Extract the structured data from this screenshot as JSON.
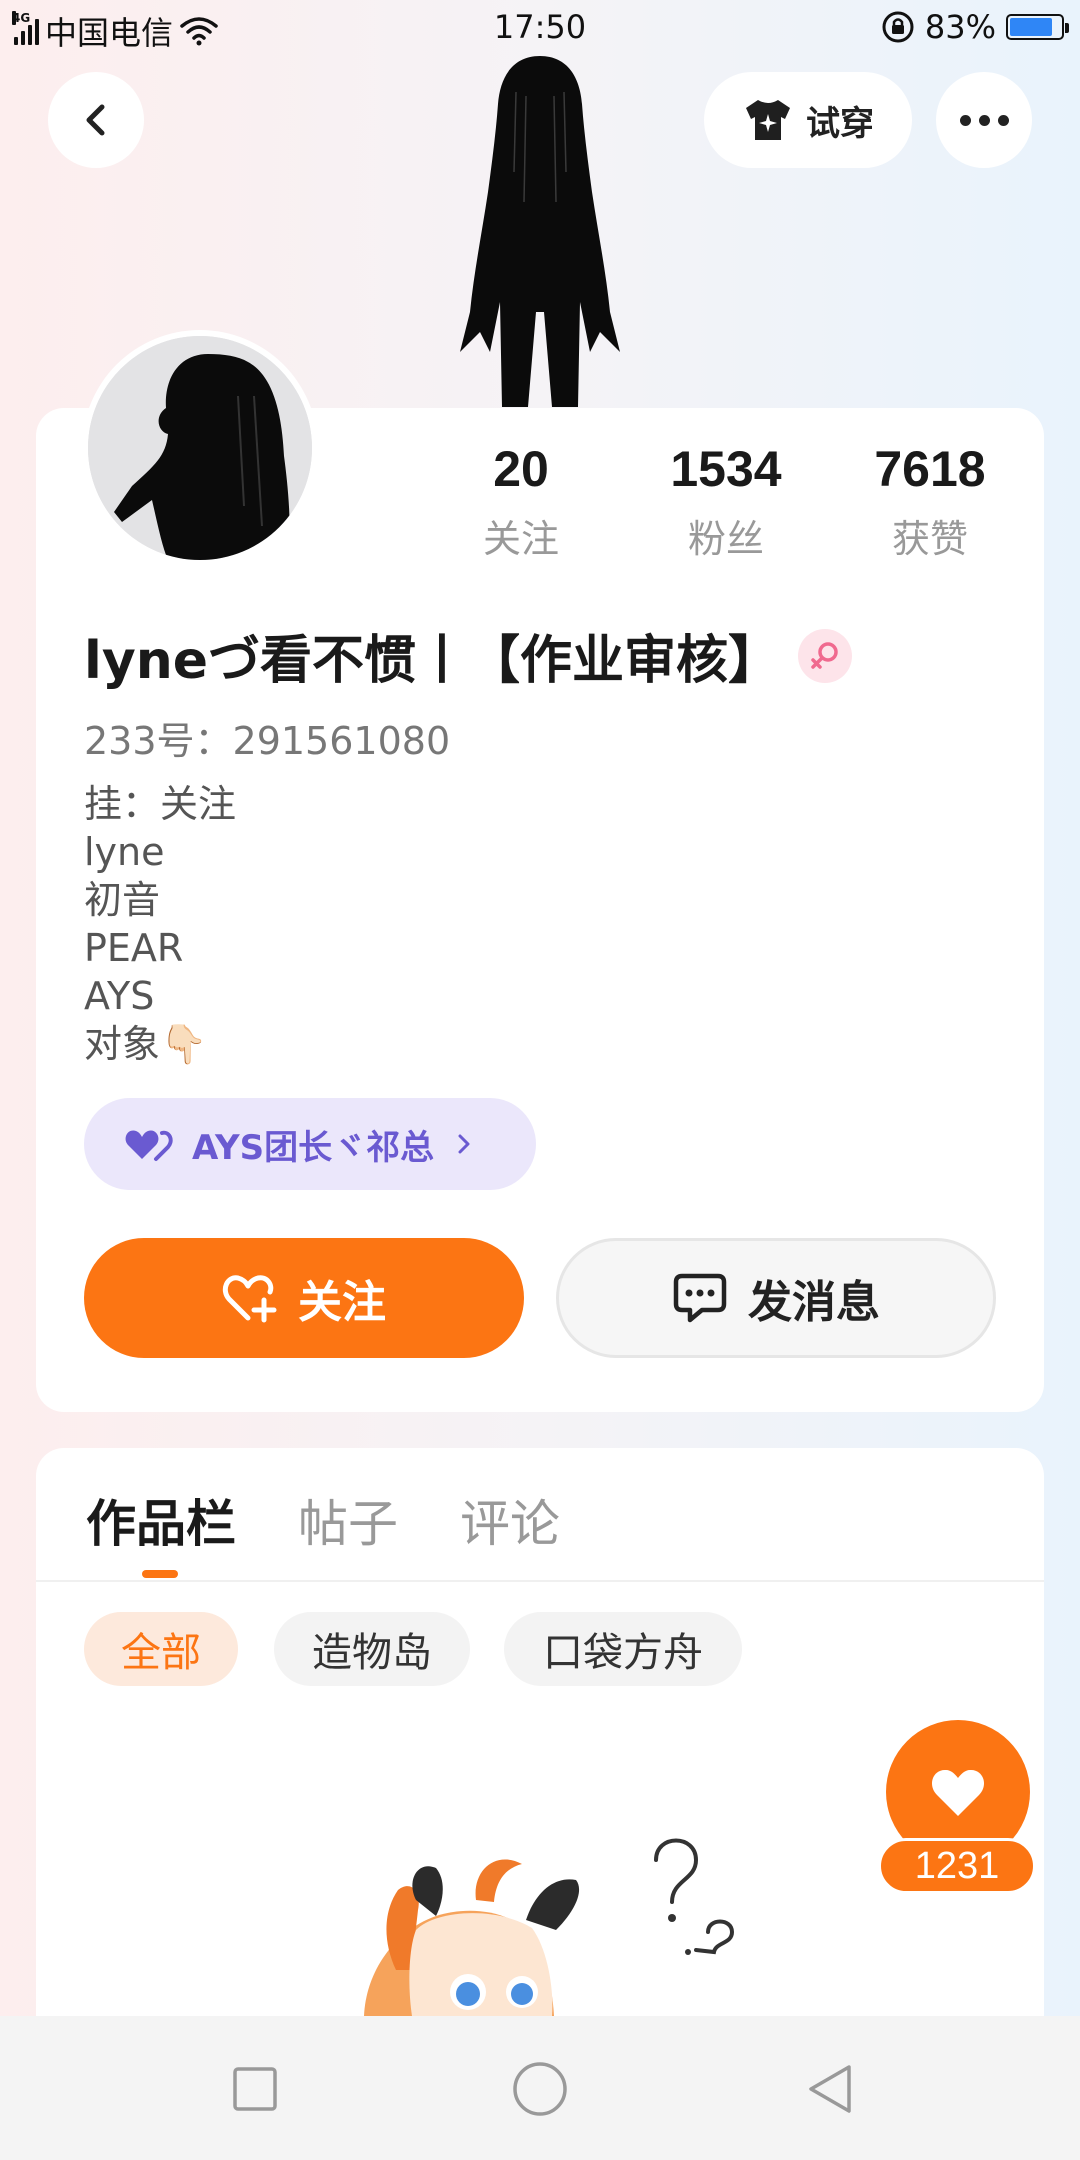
{
  "status_bar": {
    "network": "4G",
    "carrier": "中国电信",
    "time": "17:50",
    "battery_percent": "83%",
    "battery_level": 0.83
  },
  "top": {
    "tryon_label": "试穿"
  },
  "profile": {
    "stats": [
      {
        "value": "20",
        "label": "关注"
      },
      {
        "value": "1534",
        "label": "粉丝"
      },
      {
        "value": "7618",
        "label": "获赞"
      }
    ],
    "username": "lyneづ看不惯丨【作业审核】",
    "uid": "233号：291561080",
    "bio": [
      "挂：关注",
      "lyne",
      "初音",
      "PEAR",
      "AYS",
      "对象👇🏻"
    ],
    "group_label": "AYS团长ヾ祁总",
    "follow_label": "关注",
    "message_label": "发消息"
  },
  "works": {
    "tabs": [
      "作品栏",
      "帖子",
      "评论"
    ],
    "chips": [
      "全部",
      "造物岛",
      "口袋方舟"
    ],
    "like_count": "1231"
  },
  "colors": {
    "accent": "#fc7513",
    "group_text": "#6a5ad1",
    "group_bg": "#ebe7fb"
  }
}
